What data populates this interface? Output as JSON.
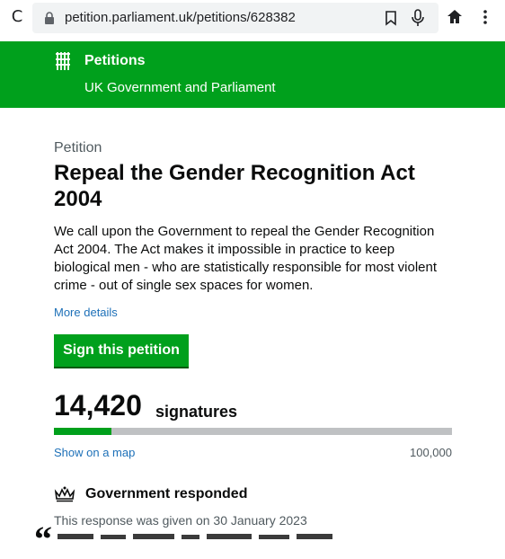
{
  "browser": {
    "url": "petition.parliament.uk/petitions/628382",
    "icons": [
      "reload-icon",
      "lock-icon",
      "bookmark-icon",
      "mic-icon",
      "home-icon",
      "more-menu-icon"
    ]
  },
  "header": {
    "brand_title": "Petitions",
    "brand_subtitle": "UK Government and Parliament",
    "background_color": "#00a01c"
  },
  "petition": {
    "kicker": "Petition",
    "title": "Repeal the Gender Recognition Act 2004",
    "description": "We call upon the Government to repeal the Gender Recognition Act 2004. The Act makes it impossible in practice to keep biological men - who are statistically responsible for most violent crime - out of single sex spaces for women.",
    "more_details_label": "More details",
    "sign_button_label": "Sign this petition"
  },
  "signatures": {
    "count": "14,420",
    "label": "signatures",
    "goal": "100,000",
    "progress_fraction": 0.1442,
    "map_link_label": "Show on a map"
  },
  "response": {
    "heading": "Government responded",
    "date_text": "This response was given on 30 January 2023"
  },
  "colors": {
    "accent_green": "#00a01c",
    "link_blue": "#1d70b8",
    "secondary_text": "#505a5f"
  }
}
